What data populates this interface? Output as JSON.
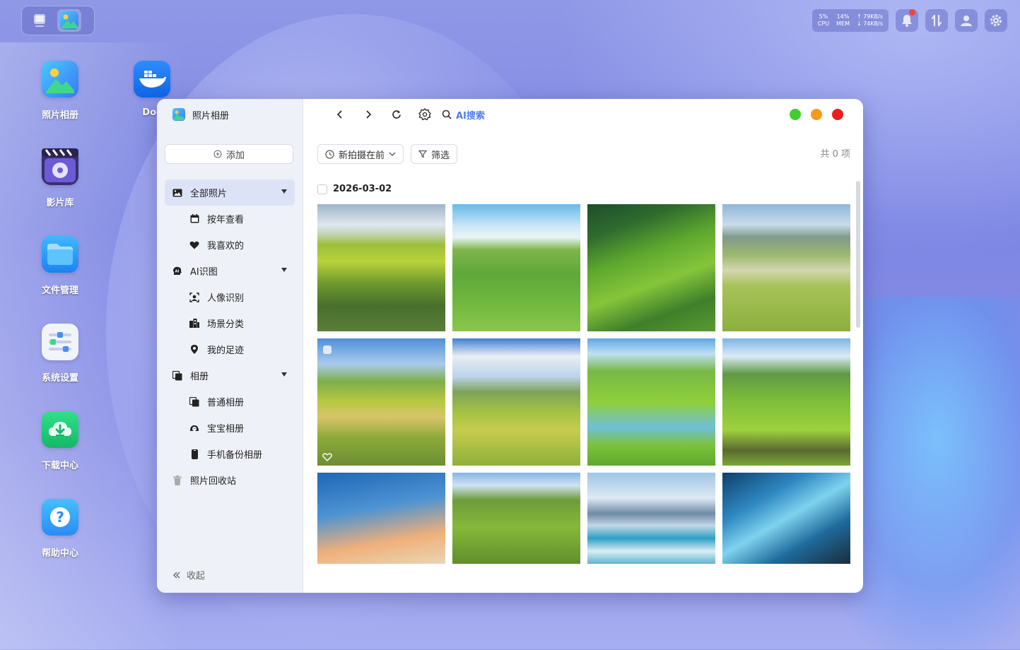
{
  "taskbar": {
    "apps": [
      {
        "icon": "desktop-icon",
        "active": false
      },
      {
        "icon": "photo-album-icon",
        "active": true
      }
    ]
  },
  "status": {
    "cpu_value": "5%",
    "cpu_label": "CPU",
    "mem_value": "14%",
    "mem_label": "MEM",
    "net_up": "↑ 79KB/s",
    "net_down": "↓ 74KB/s",
    "icons": [
      "bell-icon",
      "transfer-icon",
      "user-icon",
      "settings-gear-icon"
    ]
  },
  "desktop": {
    "icons": [
      {
        "label": "照片相册",
        "icon": "photo-album-icon"
      },
      {
        "label": "影片库",
        "icon": "video-library-icon"
      },
      {
        "label": "文件管理",
        "icon": "folder-icon"
      },
      {
        "label": "系统设置",
        "icon": "system-settings-icon"
      },
      {
        "label": "下载中心",
        "icon": "download-cloud-icon"
      },
      {
        "label": "帮助中心",
        "icon": "help-icon"
      },
      {
        "label": "Doc",
        "icon": "docker-icon"
      }
    ]
  },
  "window": {
    "title": "照片相册",
    "add_label": "添加",
    "nav": {
      "all_photos": "全部照片",
      "by_year": "按年查看",
      "favorites": "我喜欢的",
      "ai_recognition": "AI识图",
      "face_recognition": "人像识别",
      "scene_classification": "场景分类",
      "my_footprints": "我的足迹",
      "albums": "相册",
      "normal_album": "普通相册",
      "baby_album": "宝宝相册",
      "phone_backup_album": "手机备份相册",
      "recycle_bin": "照片回收站"
    },
    "collapse_label": "收起",
    "toolbar": {
      "ai_search_label": "AI搜索"
    },
    "colors": {
      "maximize": "#3fcf2e",
      "minimize": "#f59a1b",
      "close": "#ee1d1d",
      "accent": "#4b7ef0"
    },
    "sort_label": "新拍摄在前",
    "filter_label": "筛选",
    "count_label": "共 0 项",
    "date_group": "2026-03-02"
  }
}
